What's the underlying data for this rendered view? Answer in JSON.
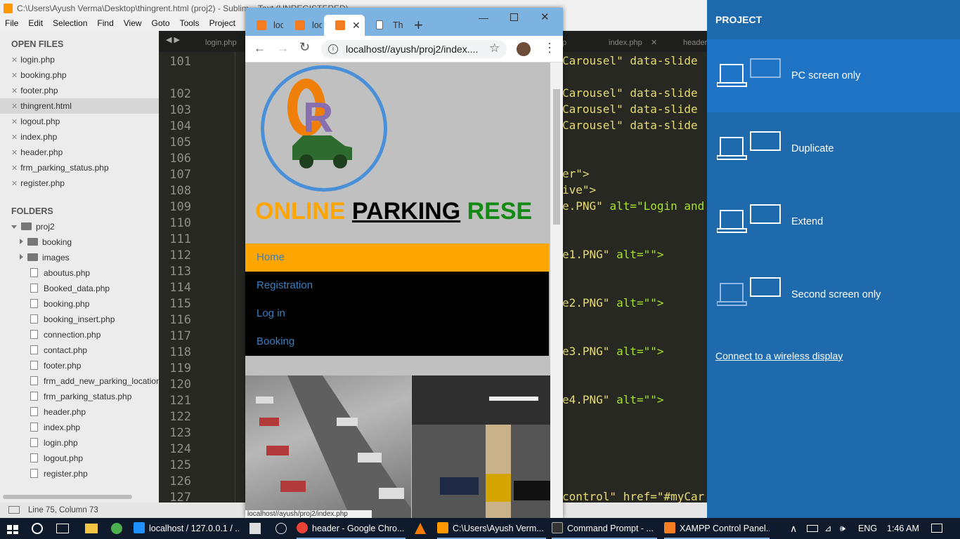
{
  "sublime": {
    "title": "C:\\Users\\Ayush Verma\\Desktop\\thingrent.html (proj2) - Sublim... Text (UNREGISTERED)",
    "menu": [
      "File",
      "Edit",
      "Selection",
      "Find",
      "View",
      "Goto",
      "Tools",
      "Project",
      "P"
    ],
    "open_files_header": "OPEN FILES",
    "open_files": [
      "login.php",
      "booking.php",
      "footer.php",
      "thingrent.html",
      "logout.php",
      "index.php",
      "header.php",
      "frm_parking_status.php",
      "register.php"
    ],
    "folders_header": "FOLDERS",
    "root_folder": "proj2",
    "subfolders": [
      "booking",
      "images"
    ],
    "files": [
      "aboutus.php",
      "Booked_data.php",
      "booking.php",
      "booking_insert.php",
      "connection.php",
      "contact.php",
      "footer.php",
      "frm_add_new_parking_location",
      "frm_parking_status.php",
      "header.php",
      "index.php",
      "login.php",
      "logout.php",
      "register.php"
    ],
    "tabs": [
      "login.php",
      "p",
      "index.php",
      "header"
    ],
    "line_numbers": [
      "101",
      "102",
      "103",
      "104",
      "105",
      "106",
      "107",
      "108",
      "109",
      "110",
      "111",
      "112",
      "113",
      "114",
      "115",
      "116",
      "117",
      "118",
      "119",
      "120",
      "121",
      "122",
      "123",
      "124",
      "125",
      "126",
      "127"
    ],
    "status": "Line 75, Column 73",
    "code": {
      "l101": "Carousel\" data-slide",
      "l102": "Carousel\" data-slide",
      "l103": "Carousel\" data-slide",
      "l104": "Carousel\" data-slide",
      "l107": "er\">",
      "l108": "ive\">",
      "l109a": "e.PNG\"",
      "l109b": "alt=\"Login and",
      "l112": "e1.PNG\"",
      "l115": "e2.PNG\"",
      "l118": "e3.PNG\"",
      "l121": "e4.PNG\"",
      "alt_empty": "alt=\"\">",
      "l127": "control\" href=\"#myCar"
    }
  },
  "chrome": {
    "tabs": [
      "loc",
      "loc",
      "",
      "Th"
    ],
    "url": "localhost//ayush/proj2/index....",
    "status_url": "localhost//ayush/proj2/index.php",
    "site": {
      "title_part1": "ONLINE ",
      "title_part2": "PARKING",
      "title_part3": " RESE",
      "nav": [
        "Home",
        "Registration",
        "Log in",
        "Booking"
      ]
    }
  },
  "project": {
    "header": "PROJECT",
    "options": [
      "PC screen only",
      "Duplicate",
      "Extend",
      "Second screen only"
    ],
    "selected": "PC screen only",
    "wireless": "Connect to a wireless display"
  },
  "taskbar": {
    "items": [
      "localhost / 127.0.0.1 / ...",
      "header - Google Chro...",
      "C:\\Users\\Ayush Verm...",
      "Command Prompt - ...",
      "XAMPP Control Panel..."
    ],
    "lang": "ENG",
    "time": "1:46 AM"
  },
  "colors": {
    "accent": "#1f74c6",
    "nav_active": "#ffa500",
    "code_bg": "#272822"
  }
}
